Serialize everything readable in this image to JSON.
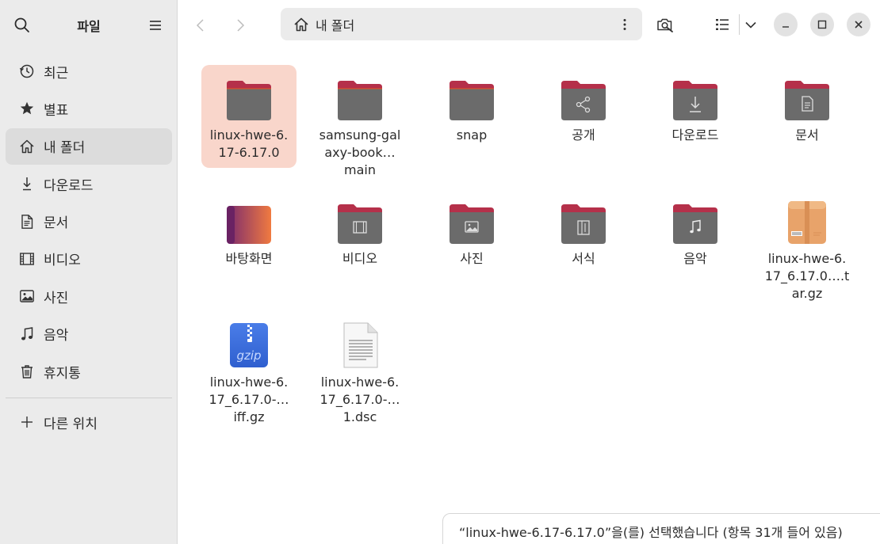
{
  "sidebar": {
    "title": "파일",
    "items": [
      {
        "label": "최근",
        "icon": "recent-clock-icon"
      },
      {
        "label": "별표",
        "icon": "star-icon"
      },
      {
        "label": "내 폴더",
        "icon": "home-icon",
        "active": true
      },
      {
        "label": "다운로드",
        "icon": "download-icon"
      },
      {
        "label": "문서",
        "icon": "document-icon"
      },
      {
        "label": "비디오",
        "icon": "video-icon"
      },
      {
        "label": "사진",
        "icon": "picture-icon"
      },
      {
        "label": "음악",
        "icon": "music-icon"
      },
      {
        "label": "휴지통",
        "icon": "trash-icon"
      }
    ],
    "other": {
      "label": "다른 위치",
      "icon": "plus-icon"
    }
  },
  "header": {
    "path": "내 폴더"
  },
  "files": [
    {
      "label": "linux-hwe-6.17-6.17.0",
      "type": "folder",
      "selected": true
    },
    {
      "label": "samsung-galaxy-book… main",
      "type": "folder"
    },
    {
      "label": "snap",
      "type": "folder"
    },
    {
      "label": "공개",
      "type": "folder-share"
    },
    {
      "label": "다운로드",
      "type": "folder-download"
    },
    {
      "label": "문서",
      "type": "folder-document"
    },
    {
      "label": "바탕화면",
      "type": "folder-desktop"
    },
    {
      "label": "비디오",
      "type": "folder-video"
    },
    {
      "label": "사진",
      "type": "folder-picture"
    },
    {
      "label": "서식",
      "type": "folder-template"
    },
    {
      "label": "음악",
      "type": "folder-music"
    },
    {
      "label": "linux-hwe-6.17_6.17.0….tar.gz",
      "type": "archive-tar"
    },
    {
      "label": "linux-hwe-6.17_6.17.0-… iff.gz",
      "type": "archive-gzip"
    },
    {
      "label": "linux-hwe-6.17_6.17.0-… 1.dsc",
      "type": "text-file"
    }
  ],
  "status": {
    "text": "“linux-hwe-6.17-6.17.0”을(를) 선택했습니다  (항목 31개 들어 있음)"
  },
  "colors": {
    "accent": "#e95420",
    "folder_tab": "#b5304a",
    "folder_body": "#6b6b6b",
    "selection": "#f9d6cb"
  }
}
